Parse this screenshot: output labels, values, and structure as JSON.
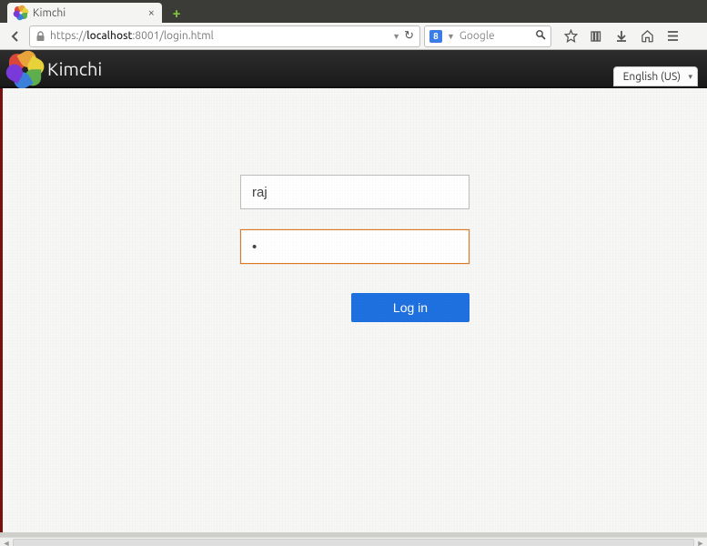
{
  "browser": {
    "tab_title": "Kimchi",
    "url_prefix": "https://",
    "url_host": "localhost",
    "url_suffix": ":8001/login.html",
    "search_placeholder": "Google"
  },
  "app": {
    "title": "Kimchi",
    "language": "English (US)"
  },
  "login": {
    "username_value": "raj",
    "password_value": "•",
    "button_label": "Log in"
  }
}
